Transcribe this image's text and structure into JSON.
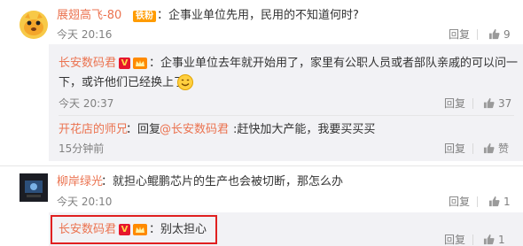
{
  "comments": [
    {
      "user": "展翅高飞-80",
      "badge": "铁粉",
      "text": "：企事业单位先用，民用的不知道何时?",
      "time": "今天 20:16",
      "reply_label": "回复",
      "likes": "9",
      "replies": [
        {
          "user": "长安数码君",
          "text_line1": "：企事业单位去年就开始用了，家里有公职人员或者部队亲戚的可以问一",
          "text_line2": "下，或许他们已经换上了",
          "time": "今天 20:37",
          "reply_label": "回复",
          "likes": "37"
        },
        {
          "user": "开花店的师兄",
          "reply_word": "：回复",
          "mention": "@长安数码君",
          "text": ":赶快加大产能，我要买买买",
          "time": "15分钟前",
          "reply_label": "回复",
          "like_label": "赞"
        }
      ]
    },
    {
      "user": "柳岸绿光",
      "text": "：就担心鲲鹏芯片的生产也会被切断，那怎么办",
      "time": "今天 20:10",
      "reply_label": "回复",
      "likes": "1",
      "replies": [
        {
          "user": "长安数码君",
          "text": "：别太担心",
          "reply_label": "回复",
          "likes": "1"
        }
      ]
    }
  ],
  "colors": {
    "username": "#eb7350",
    "text": "#333333",
    "meta": "#808080",
    "subbox": "#f2f2f5",
    "highlight": "#e02020"
  },
  "icons": [
    "avatar-doge",
    "avatar-dark",
    "v-badge-icon",
    "crown-badge-icon",
    "smile-emoji-icon",
    "thumbs-up-icon"
  ]
}
